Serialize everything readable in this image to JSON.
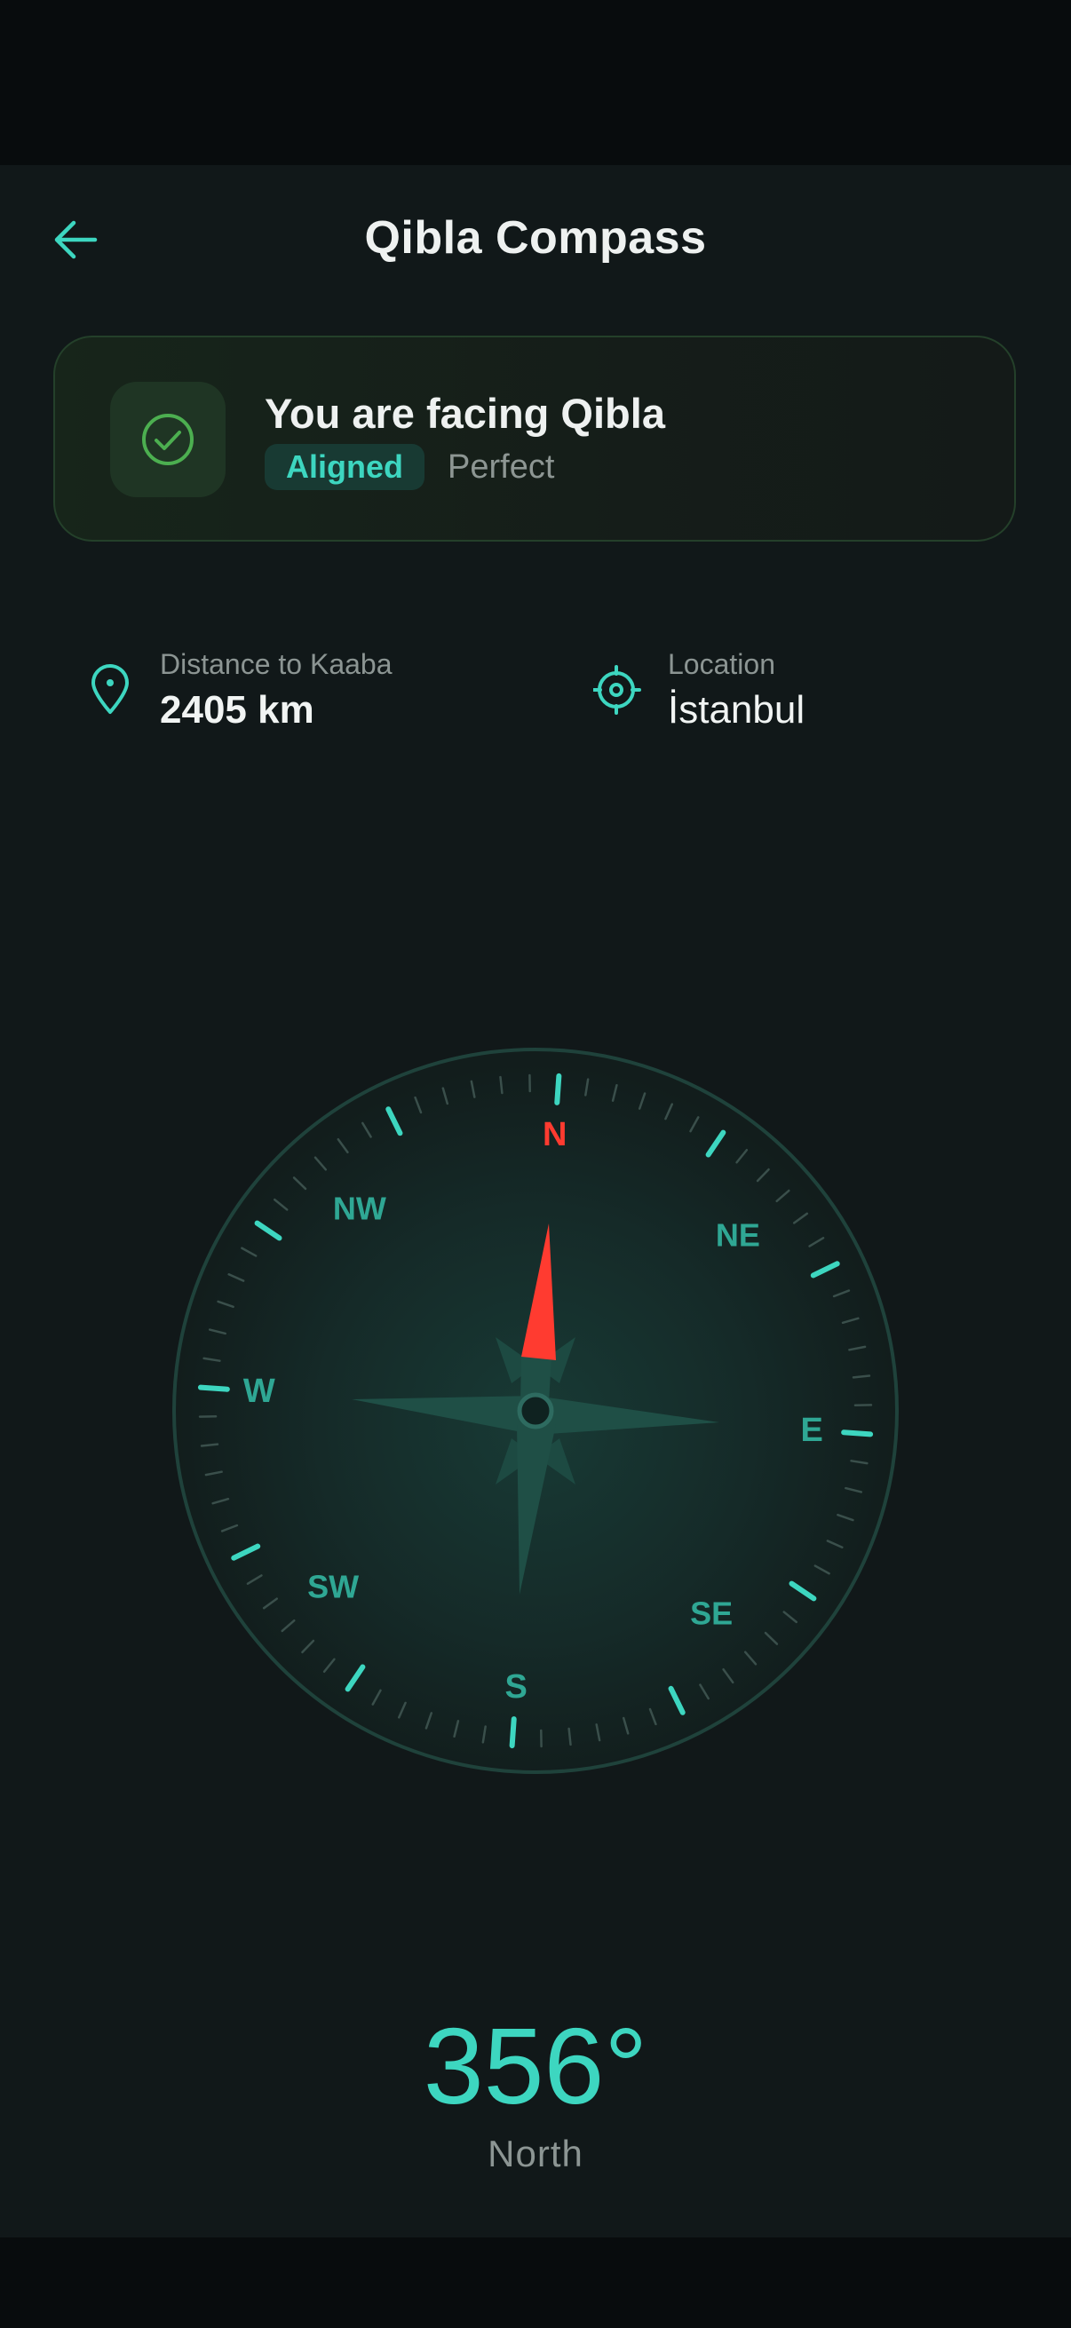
{
  "header": {
    "title": "Qibla Compass",
    "back_icon": "arrow-left-icon"
  },
  "status_card": {
    "title": "You are facing Qibla",
    "badge": "Aligned",
    "quality": "Perfect",
    "icon": "check-circle-icon"
  },
  "distance": {
    "label": "Distance to Kaaba",
    "value": "2405 km",
    "icon": "map-pin-icon"
  },
  "location": {
    "label": "Location",
    "value": "İstanbul",
    "icon": "crosshair-icon"
  },
  "compass": {
    "cardinals": [
      "N",
      "E",
      "S",
      "W"
    ],
    "intercardinals": [
      "NE",
      "SE",
      "SW",
      "NW"
    ],
    "heading_deg": 356
  },
  "heading": {
    "value": "356°",
    "label": "North"
  },
  "colors": {
    "accent": "#3dd6c0",
    "north_red": "#ff3b30",
    "success_green": "#4caf50",
    "background": "#111819"
  }
}
